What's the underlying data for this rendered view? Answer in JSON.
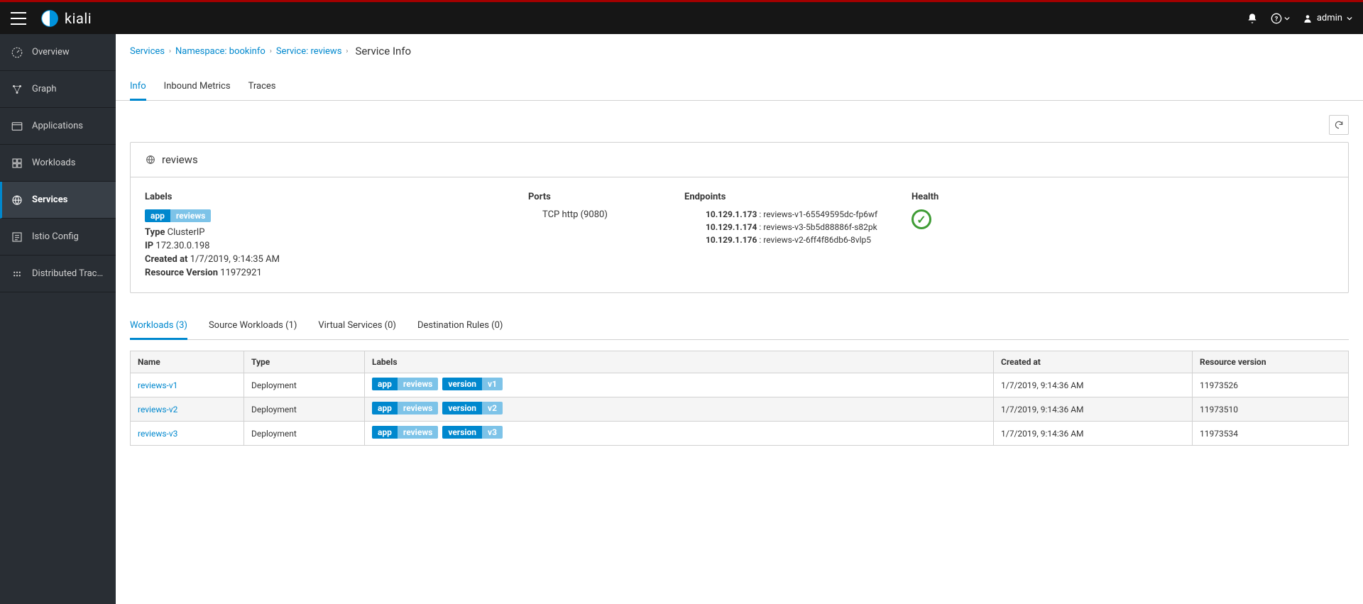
{
  "topbar": {
    "brand": "kiali",
    "user": "admin"
  },
  "sidebar": {
    "items": [
      {
        "label": "Overview"
      },
      {
        "label": "Graph"
      },
      {
        "label": "Applications"
      },
      {
        "label": "Workloads"
      },
      {
        "label": "Services"
      },
      {
        "label": "Istio Config"
      },
      {
        "label": "Distributed Traci..."
      }
    ]
  },
  "breadcrumb": {
    "l0": "Services",
    "l1": "Namespace: bookinfo",
    "l2": "Service: reviews",
    "current": "Service Info"
  },
  "tabs": {
    "t0": "Info",
    "t1": "Inbound Metrics",
    "t2": "Traces"
  },
  "service": {
    "name": "reviews",
    "labelsTitle": "Labels",
    "labelKey": "app",
    "labelVal": "reviews",
    "typeLabel": "Type",
    "typeVal": "ClusterIP",
    "ipLabel": "IP",
    "ipVal": "172.30.0.198",
    "createdLabel": "Created at",
    "createdVal": "1/7/2019, 9:14:35 AM",
    "rvLabel": "Resource Version",
    "rvVal": "11972921",
    "portsTitle": "Ports",
    "portsVal": "TCP http (9080)",
    "endpointsTitle": "Endpoints",
    "ep": [
      {
        "ip": "10.129.1.173",
        "name": "reviews-v1-65549595dc-fp6wf"
      },
      {
        "ip": "10.129.1.174",
        "name": "reviews-v3-5b5d88886f-s82pk"
      },
      {
        "ip": "10.129.1.176",
        "name": "reviews-v2-6ff4f86db6-8vlp5"
      }
    ],
    "healthTitle": "Health"
  },
  "subtabs": {
    "t0": "Workloads (3)",
    "t1": "Source Workloads (1)",
    "t2": "Virtual Services (0)",
    "t3": "Destination Rules (0)"
  },
  "table": {
    "h0": "Name",
    "h1": "Type",
    "h2": "Labels",
    "h3": "Created at",
    "h4": "Resource version",
    "rows": [
      {
        "name": "reviews-v1",
        "type": "Deployment",
        "app": "app",
        "appVal": "reviews",
        "ver": "version",
        "verVal": "v1",
        "created": "1/7/2019, 9:14:36 AM",
        "rv": "11973526"
      },
      {
        "name": "reviews-v2",
        "type": "Deployment",
        "app": "app",
        "appVal": "reviews",
        "ver": "version",
        "verVal": "v2",
        "created": "1/7/2019, 9:14:36 AM",
        "rv": "11973510"
      },
      {
        "name": "reviews-v3",
        "type": "Deployment",
        "app": "app",
        "appVal": "reviews",
        "ver": "version",
        "verVal": "v3",
        "created": "1/7/2019, 9:14:36 AM",
        "rv": "11973534"
      }
    ]
  }
}
